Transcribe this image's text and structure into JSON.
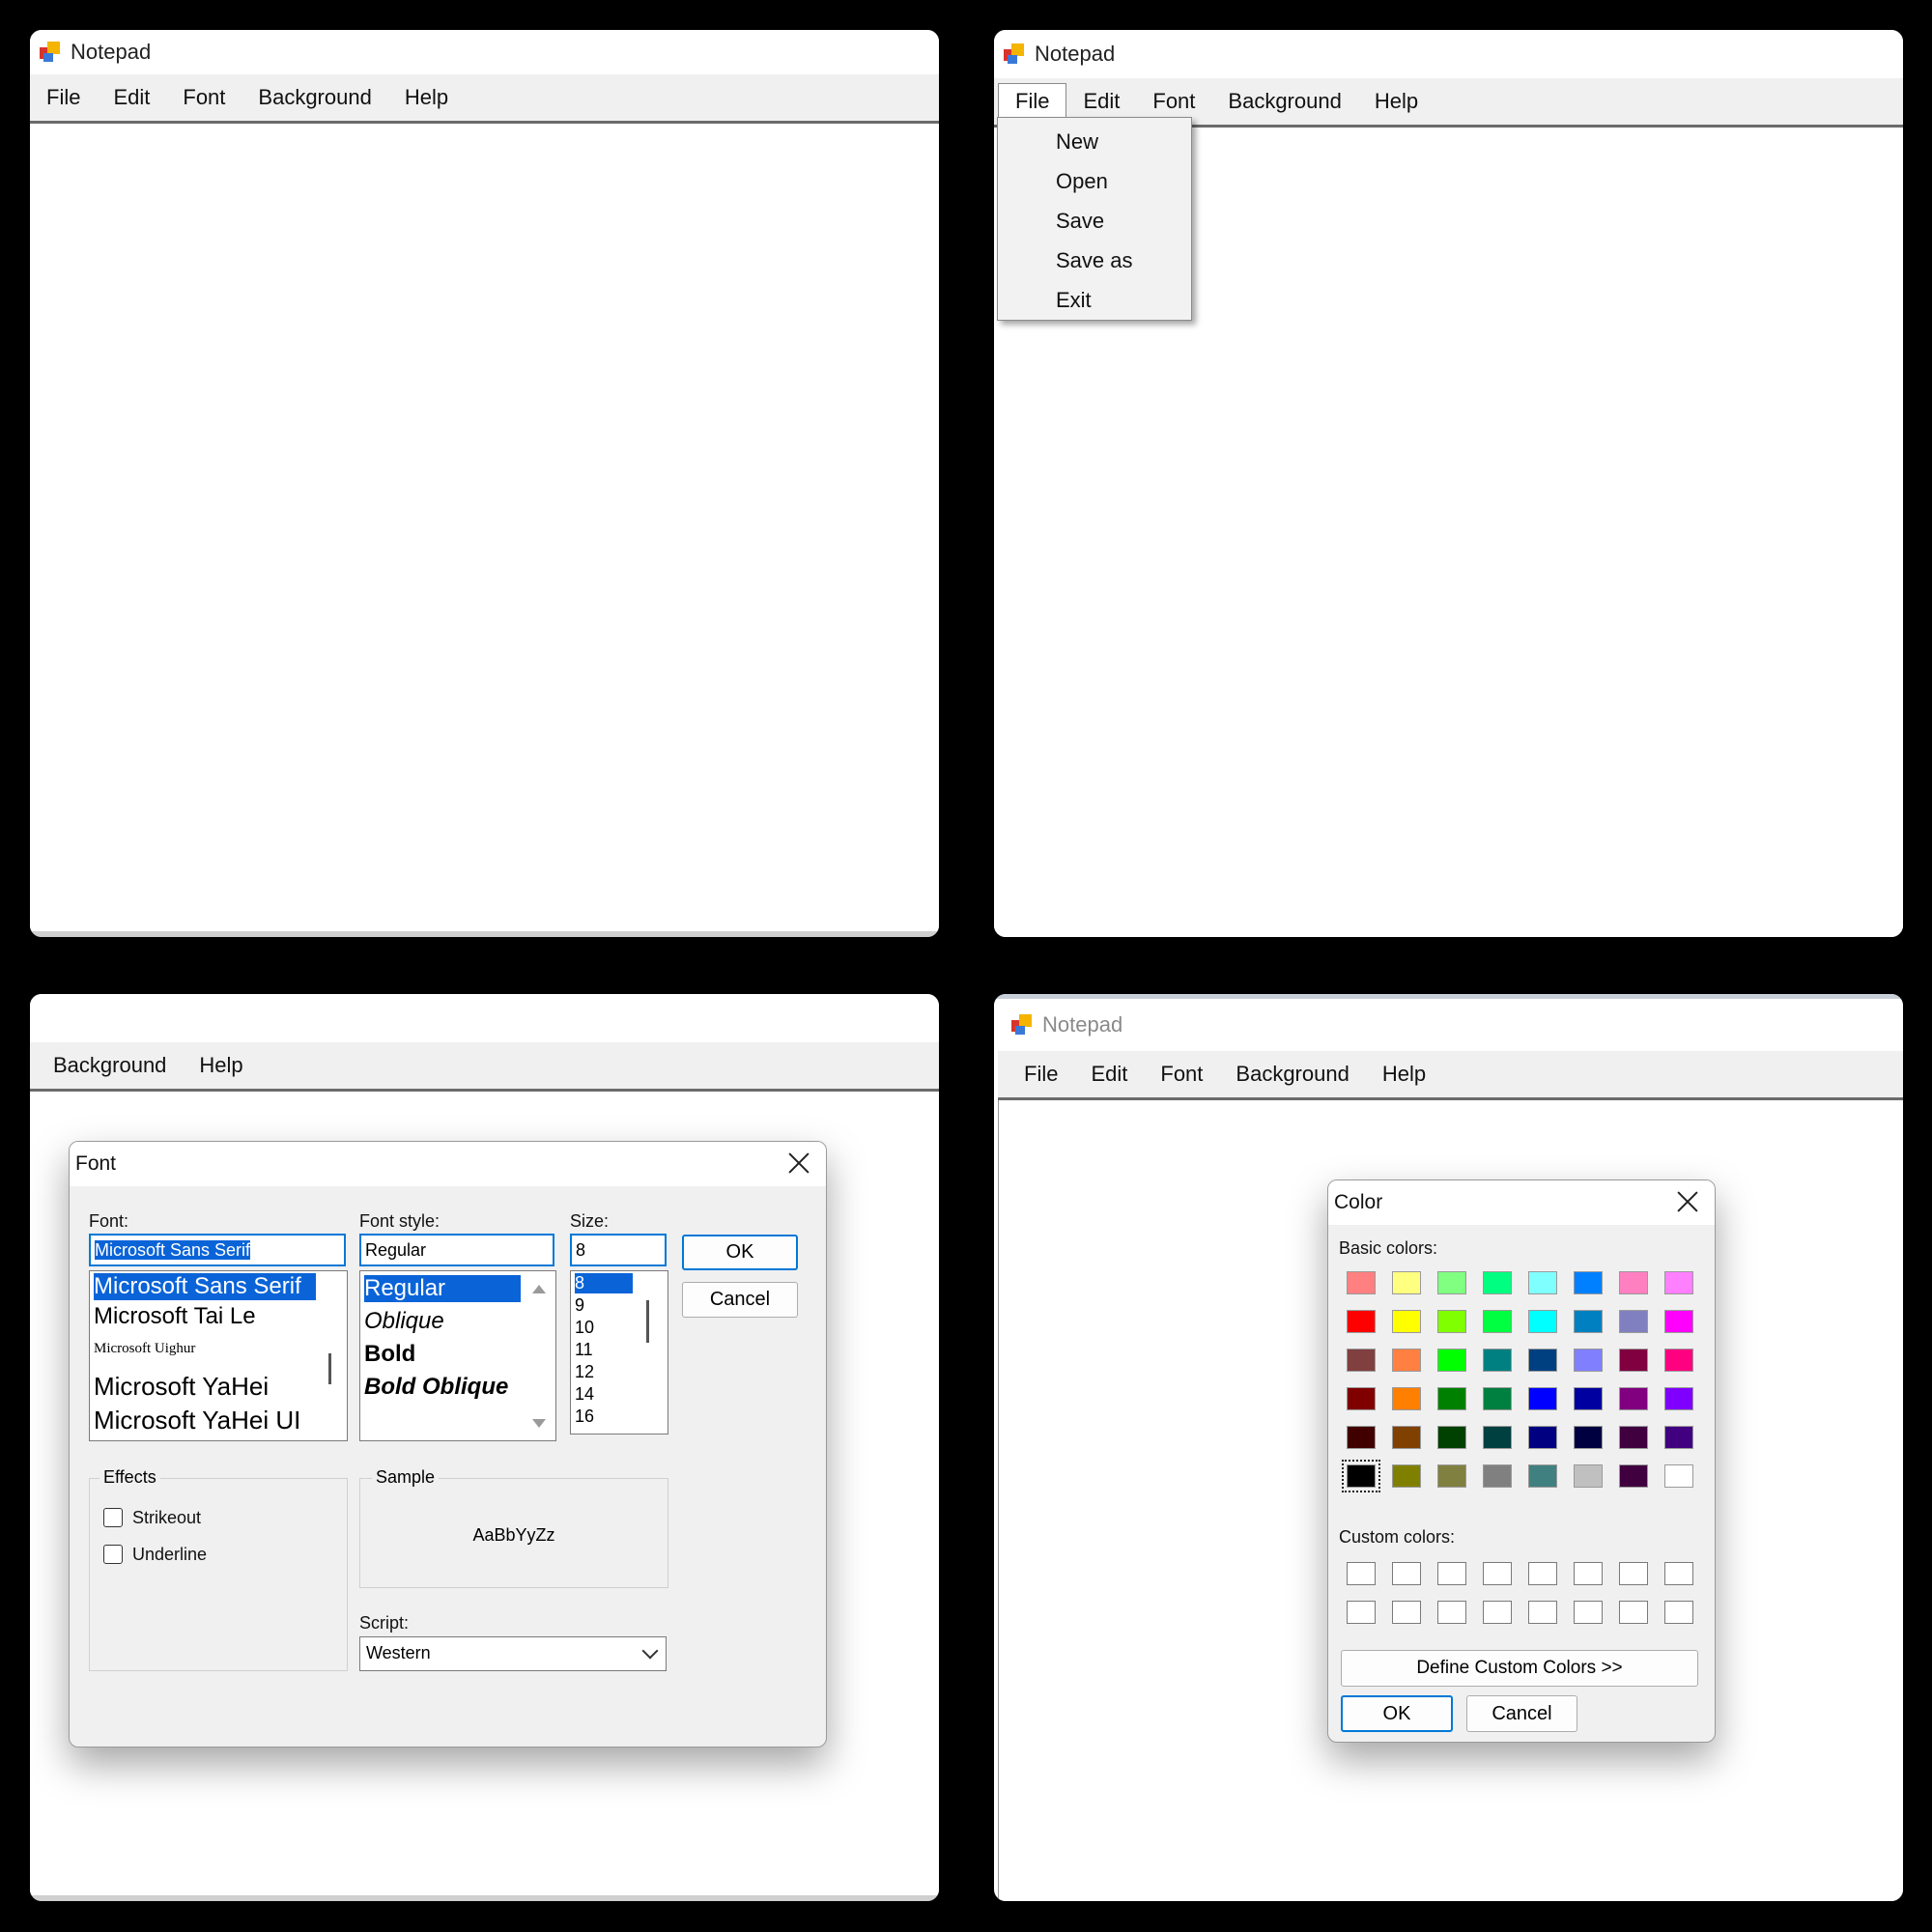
{
  "app_title": "Notepad",
  "menu": [
    "File",
    "Edit",
    "Font",
    "Background",
    "Help"
  ],
  "menu_partial": [
    "Background",
    "Help"
  ],
  "file_menu": [
    "New",
    "Open",
    "Save",
    "Save as",
    "Exit"
  ],
  "font_dialog": {
    "title": "Font",
    "font_label": "Font:",
    "font_value": "Microsoft Sans Serif",
    "font_list": [
      "Microsoft Sans Serif",
      "Microsoft Tai Le",
      "Microsoft Uighur",
      "Microsoft YaHei",
      "Microsoft YaHei UI"
    ],
    "style_label": "Font style:",
    "style_value": "Regular",
    "style_list": [
      "Regular",
      "Oblique",
      "Bold",
      "Bold Oblique"
    ],
    "size_label": "Size:",
    "size_value": "8",
    "size_list": [
      "8",
      "9",
      "10",
      "11",
      "12",
      "14",
      "16"
    ],
    "ok": "OK",
    "cancel": "Cancel",
    "effects_label": "Effects",
    "strikeout": "Strikeout",
    "underline": "Underline",
    "sample_label": "Sample",
    "sample_text": "AaBbYyZz",
    "script_label": "Script:",
    "script_value": "Western"
  },
  "color_dialog": {
    "title": "Color",
    "basic_label": "Basic colors:",
    "custom_label": "Custom colors:",
    "define_button": "Define Custom Colors >>",
    "ok": "OK",
    "cancel": "Cancel",
    "basic_colors": [
      [
        "#ff8080",
        "#ffff80",
        "#80ff80",
        "#00ff80",
        "#80ffff",
        "#0080ff",
        "#ff80c0",
        "#ff80ff"
      ],
      [
        "#ff0000",
        "#ffff00",
        "#80ff00",
        "#00ff40",
        "#00ffff",
        "#0080c0",
        "#8080c0",
        "#ff00ff"
      ],
      [
        "#804040",
        "#ff8040",
        "#00ff00",
        "#008080",
        "#004080",
        "#8080ff",
        "#800040",
        "#ff0080"
      ],
      [
        "#800000",
        "#ff8000",
        "#008000",
        "#008040",
        "#0000ff",
        "#0000a0",
        "#800080",
        "#8000ff"
      ],
      [
        "#400000",
        "#804000",
        "#004000",
        "#004040",
        "#000080",
        "#000040",
        "#400040",
        "#400080"
      ],
      [
        "#000000",
        "#808000",
        "#808040",
        "#808080",
        "#408080",
        "#c0c0c0",
        "#400040",
        "#ffffff"
      ]
    ]
  }
}
